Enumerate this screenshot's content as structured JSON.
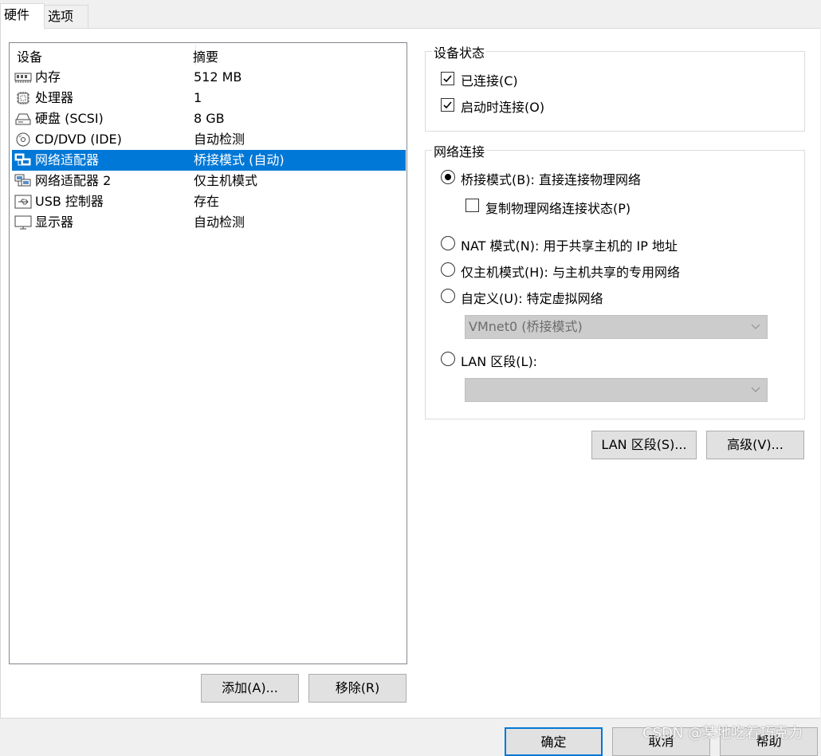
{
  "tabs": [
    {
      "label": "硬件",
      "active": true
    },
    {
      "label": "选项",
      "active": false
    }
  ],
  "device_list": {
    "columns": [
      "设备",
      "摘要"
    ],
    "rows": [
      {
        "icon": "memory-icon",
        "name": "内存",
        "summary": "512 MB",
        "selected": false
      },
      {
        "icon": "processor-icon",
        "name": "处理器",
        "summary": "1",
        "selected": false
      },
      {
        "icon": "harddisk-icon",
        "name": "硬盘 (SCSI)",
        "summary": "8 GB",
        "selected": false
      },
      {
        "icon": "cd-dvd-icon",
        "name": "CD/DVD (IDE)",
        "summary": "自动检测",
        "selected": false
      },
      {
        "icon": "network-adapter-icon",
        "name": "网络适配器",
        "summary": "桥接模式 (自动)",
        "selected": true
      },
      {
        "icon": "network-adapter-icon",
        "name": "网络适配器 2",
        "summary": "仅主机模式",
        "selected": false
      },
      {
        "icon": "usb-icon",
        "name": "USB 控制器",
        "summary": "存在",
        "selected": false
      },
      {
        "icon": "display-icon",
        "name": "显示器",
        "summary": "自动检测",
        "selected": false
      }
    ]
  },
  "list_buttons": {
    "add": "添加(A)...",
    "remove": "移除(R)"
  },
  "device_status": {
    "title": "设备状态",
    "connected": {
      "label": "已连接(C)",
      "checked": true
    },
    "connect_at_power_on": {
      "label": "启动时连接(O)",
      "checked": true
    }
  },
  "network_connection": {
    "title": "网络连接",
    "bridged": {
      "label": "桥接模式(B): 直接连接物理网络",
      "selected": true
    },
    "replicate": {
      "label": "复制物理网络连接状态(P)",
      "checked": false
    },
    "nat": {
      "label": "NAT 模式(N): 用于共享主机的 IP 地址",
      "selected": false
    },
    "host_only": {
      "label": "仅主机模式(H): 与主机共享的专用网络",
      "selected": false
    },
    "custom": {
      "label": "自定义(U): 特定虚拟网络",
      "selected": false
    },
    "custom_combo_value": "VMnet0 (桥接模式)",
    "lan_segment": {
      "label": "LAN 区段(L):",
      "selected": false
    },
    "lan_combo_value": ""
  },
  "right_buttons": {
    "lan_segments": "LAN 区段(S)...",
    "advanced": "高级(V)..."
  },
  "footer_buttons": {
    "ok": "确定",
    "cancel": "取消",
    "help": "帮助"
  },
  "watermark": "CSDN @某地吃着巧克力",
  "colors": {
    "selection": "#0078d7",
    "window_bg": "#f0f0f0"
  }
}
